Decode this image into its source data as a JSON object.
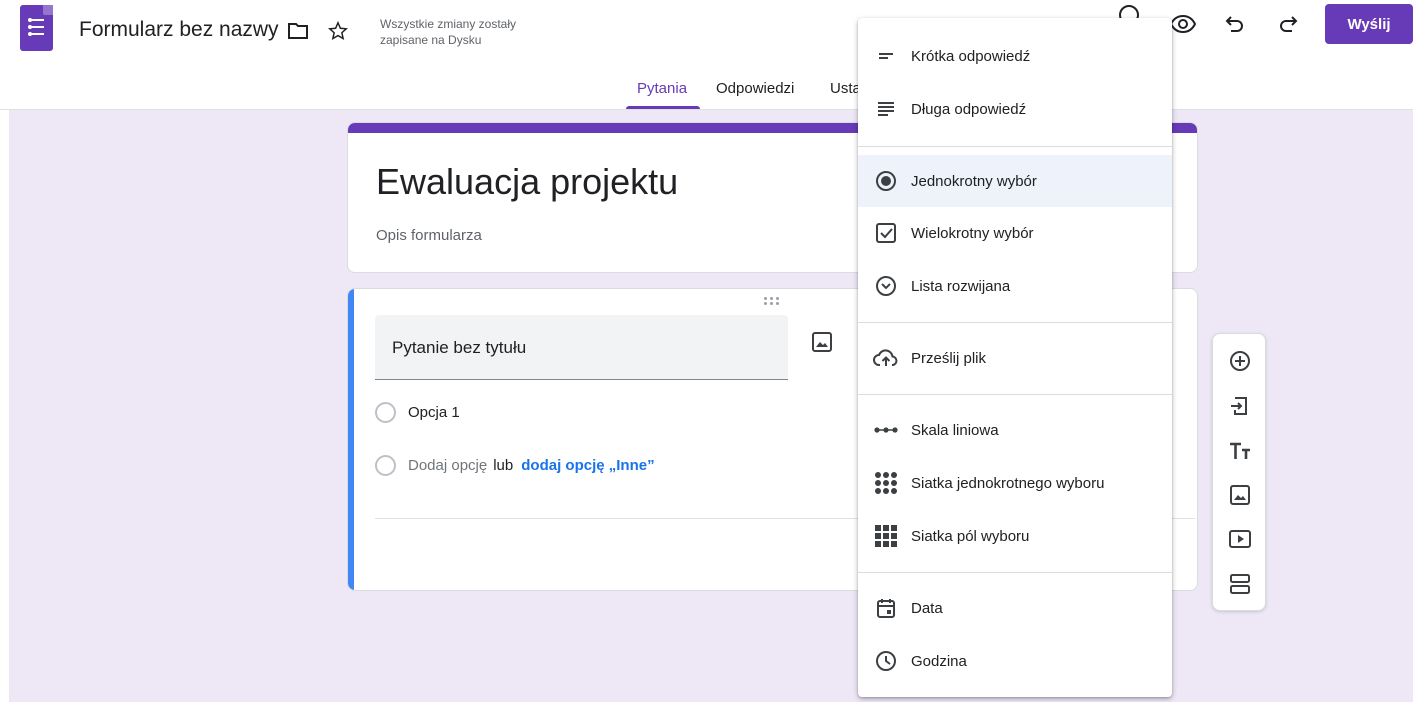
{
  "header": {
    "doc_title": "Formularz bez nazwy",
    "save_status": "Wszystkie zmiany zostały zapisane na Dysku",
    "send_label": "Wyślij"
  },
  "tabs": [
    {
      "label": "Pytania",
      "active": true
    },
    {
      "label": "Odpowiedzi",
      "active": false
    },
    {
      "label": "Usta",
      "active": false
    }
  ],
  "form": {
    "title": "Ewaluacja projektu",
    "description_placeholder": "Opis formularza"
  },
  "question": {
    "title_placeholder": "Pytanie bez tytułu",
    "options": [
      "Opcja 1"
    ],
    "add_option": "Dodaj opcję",
    "or_text": "lub",
    "add_other": "dodaj opcję „Inne”"
  },
  "type_menu": {
    "items": [
      {
        "label": "Krótka odpowiedź",
        "icon": "short-text-icon"
      },
      {
        "label": "Długa odpowiedź",
        "icon": "paragraph-icon"
      },
      {
        "label": "Jednokrotny wybór",
        "icon": "radio-button-icon",
        "selected": true
      },
      {
        "label": "Wielokrotny wybór",
        "icon": "checkbox-icon"
      },
      {
        "label": "Lista rozwijana",
        "icon": "dropdown-icon"
      },
      {
        "label": "Prześlij plik",
        "icon": "cloud-upload-icon"
      },
      {
        "label": "Skala liniowa",
        "icon": "linear-scale-icon"
      },
      {
        "label": "Siatka jednokrotnego wyboru",
        "icon": "multiple-choice-grid-icon"
      },
      {
        "label": "Siatka pól wyboru",
        "icon": "checkbox-grid-icon"
      },
      {
        "label": "Data",
        "icon": "calendar-icon"
      },
      {
        "label": "Godzina",
        "icon": "clock-icon"
      }
    ]
  },
  "colors": {
    "accent": "#673ab7",
    "background": "#ede7f6",
    "active_question": "#4285f4",
    "link": "#1a73e8"
  }
}
